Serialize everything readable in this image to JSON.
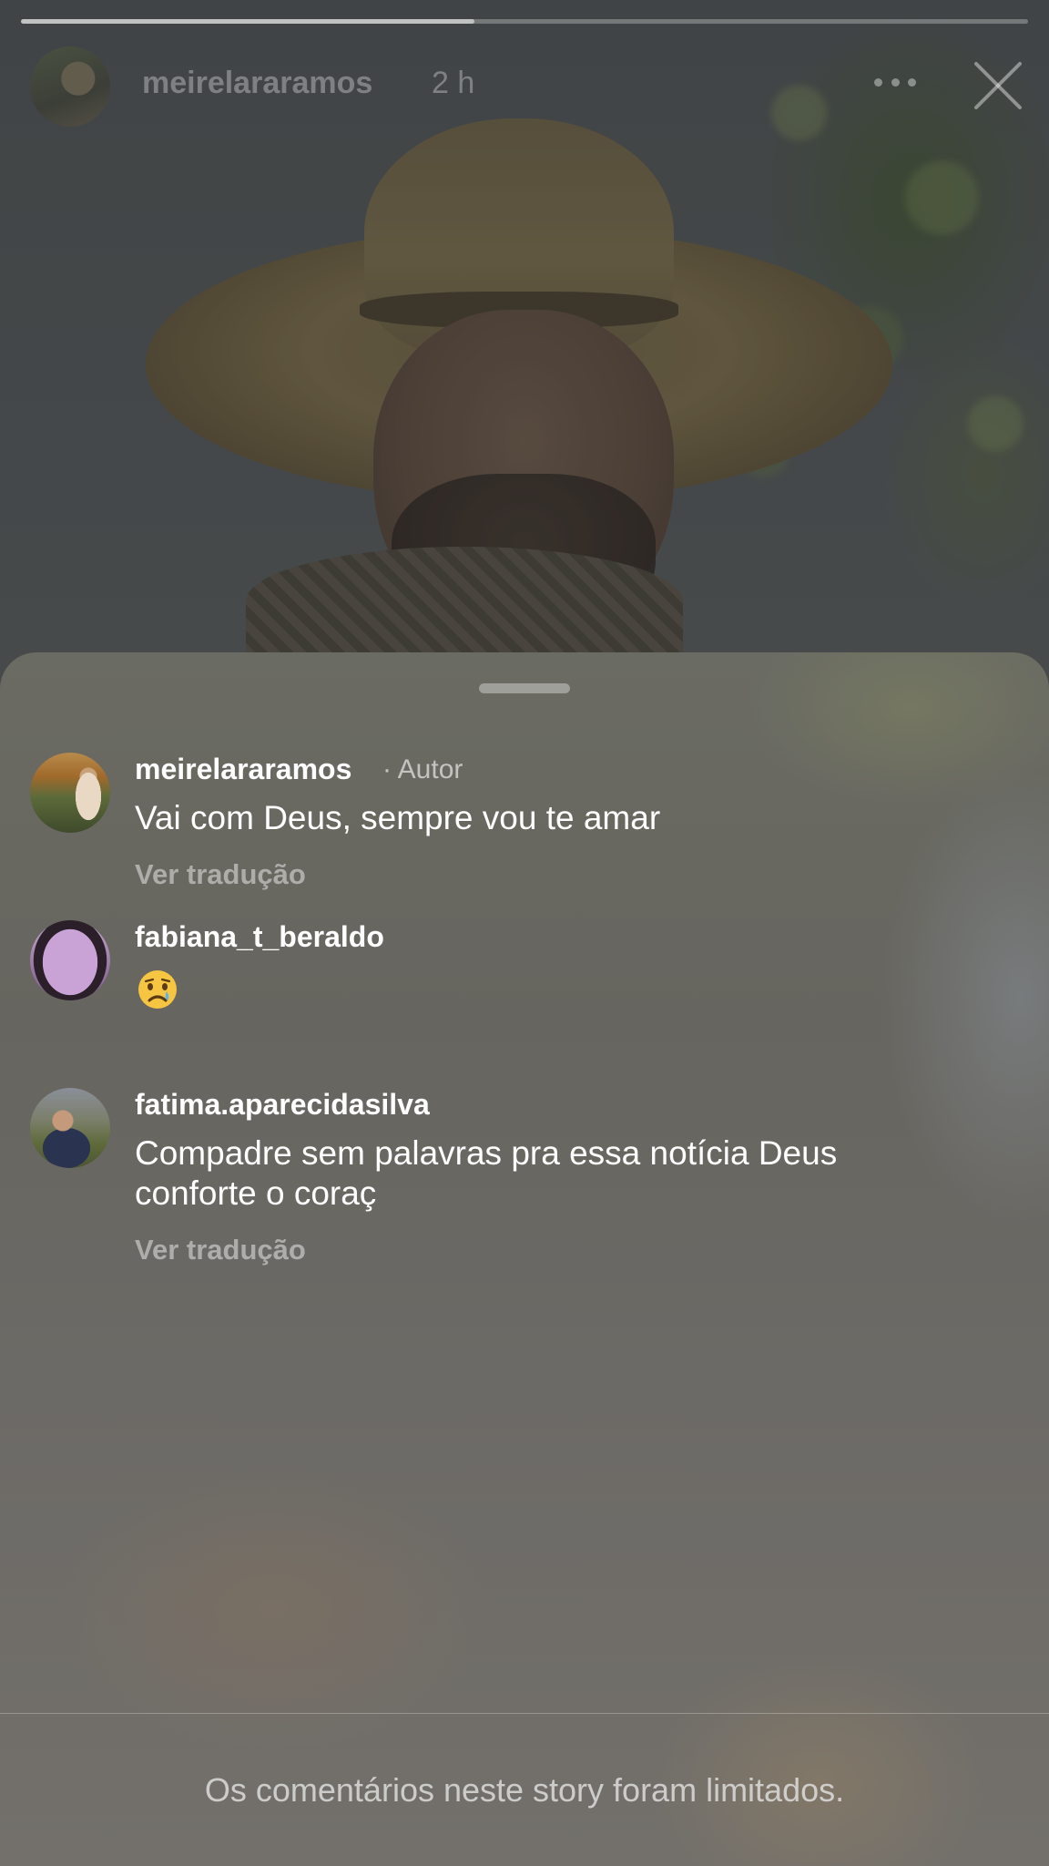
{
  "story": {
    "username": "meirelararamos",
    "time": "2 h",
    "progress": 0.45,
    "more_icon": "more-horizontal-icon",
    "close_icon": "close-icon"
  },
  "comments": [
    {
      "username": "meirelararamos",
      "author_tag": "· Autor",
      "text": "Vai com Deus, sempre vou te amar",
      "translate": "Ver tradução"
    },
    {
      "username": "fabiana_t_beraldo",
      "emoji": "crying-face-emoji"
    },
    {
      "username": "fatima.aparecidasilva",
      "text": "Compadre sem palavras pra essa notícia Deus conforte o coraç",
      "translate": "Ver tradução"
    }
  ],
  "footer": {
    "notice": "Os comentários neste story foram limitados."
  },
  "colors": {
    "text_primary": "#ffffff",
    "text_muted": "#d6d6d6"
  }
}
